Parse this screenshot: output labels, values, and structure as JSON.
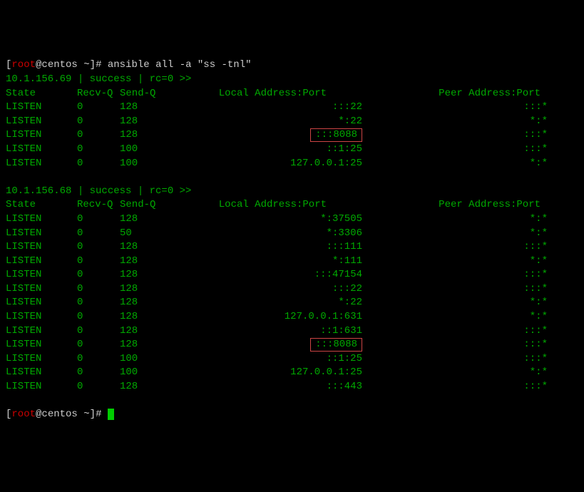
{
  "prompt": {
    "open": "[",
    "user": "root",
    "at": "@",
    "host": "centos",
    "space": " ",
    "tilde": "~",
    "close": "]",
    "symbol": "# "
  },
  "command": "ansible all -a \"ss -tnl\"",
  "hosts": [
    {
      "header": "10.1.156.69 | success | rc=0 >>",
      "columns": {
        "state": "State",
        "recvq": "Recv-Q",
        "sendq": "Send-Q",
        "local": "Local Address:Port",
        "peer": "Peer Address:Port"
      },
      "rows": [
        {
          "state": "LISTEN",
          "recvq": "0",
          "sendq": "128",
          "local": ":::22",
          "peer": ":::*",
          "highlight": false
        },
        {
          "state": "LISTEN",
          "recvq": "0",
          "sendq": "128",
          "local": "*:22",
          "peer": "*:*",
          "highlight": false
        },
        {
          "state": "LISTEN",
          "recvq": "0",
          "sendq": "128",
          "local": ":::8088",
          "peer": ":::*",
          "highlight": true
        },
        {
          "state": "LISTEN",
          "recvq": "0",
          "sendq": "100",
          "local": "::1:25",
          "peer": ":::*",
          "highlight": false
        },
        {
          "state": "LISTEN",
          "recvq": "0",
          "sendq": "100",
          "local": "127.0.0.1:25",
          "peer": "*:*",
          "highlight": false
        }
      ]
    },
    {
      "header": "10.1.156.68 | success | rc=0 >>",
      "columns": {
        "state": "State",
        "recvq": "Recv-Q",
        "sendq": "Send-Q",
        "local": "Local Address:Port",
        "peer": "Peer Address:Port"
      },
      "rows": [
        {
          "state": "LISTEN",
          "recvq": "0",
          "sendq": "128",
          "local": "*:37505",
          "peer": "*:*",
          "highlight": false
        },
        {
          "state": "LISTEN",
          "recvq": "0",
          "sendq": "50",
          "local": "*:3306",
          "peer": "*:*",
          "highlight": false
        },
        {
          "state": "LISTEN",
          "recvq": "0",
          "sendq": "128",
          "local": ":::111",
          "peer": ":::*",
          "highlight": false
        },
        {
          "state": "LISTEN",
          "recvq": "0",
          "sendq": "128",
          "local": "*:111",
          "peer": "*:*",
          "highlight": false
        },
        {
          "state": "LISTEN",
          "recvq": "0",
          "sendq": "128",
          "local": ":::47154",
          "peer": ":::*",
          "highlight": false
        },
        {
          "state": "LISTEN",
          "recvq": "0",
          "sendq": "128",
          "local": ":::22",
          "peer": ":::*",
          "highlight": false
        },
        {
          "state": "LISTEN",
          "recvq": "0",
          "sendq": "128",
          "local": "*:22",
          "peer": "*:*",
          "highlight": false
        },
        {
          "state": "LISTEN",
          "recvq": "0",
          "sendq": "128",
          "local": "127.0.0.1:631",
          "peer": "*:*",
          "highlight": false
        },
        {
          "state": "LISTEN",
          "recvq": "0",
          "sendq": "128",
          "local": "::1:631",
          "peer": ":::*",
          "highlight": false
        },
        {
          "state": "LISTEN",
          "recvq": "0",
          "sendq": "128",
          "local": ":::8088",
          "peer": ":::*",
          "highlight": true
        },
        {
          "state": "LISTEN",
          "recvq": "0",
          "sendq": "100",
          "local": "::1:25",
          "peer": ":::*",
          "highlight": false
        },
        {
          "state": "LISTEN",
          "recvq": "0",
          "sendq": "100",
          "local": "127.0.0.1:25",
          "peer": "*:*",
          "highlight": false
        },
        {
          "state": "LISTEN",
          "recvq": "0",
          "sendq": "128",
          "local": ":::443",
          "peer": ":::*",
          "highlight": false
        }
      ]
    }
  ]
}
